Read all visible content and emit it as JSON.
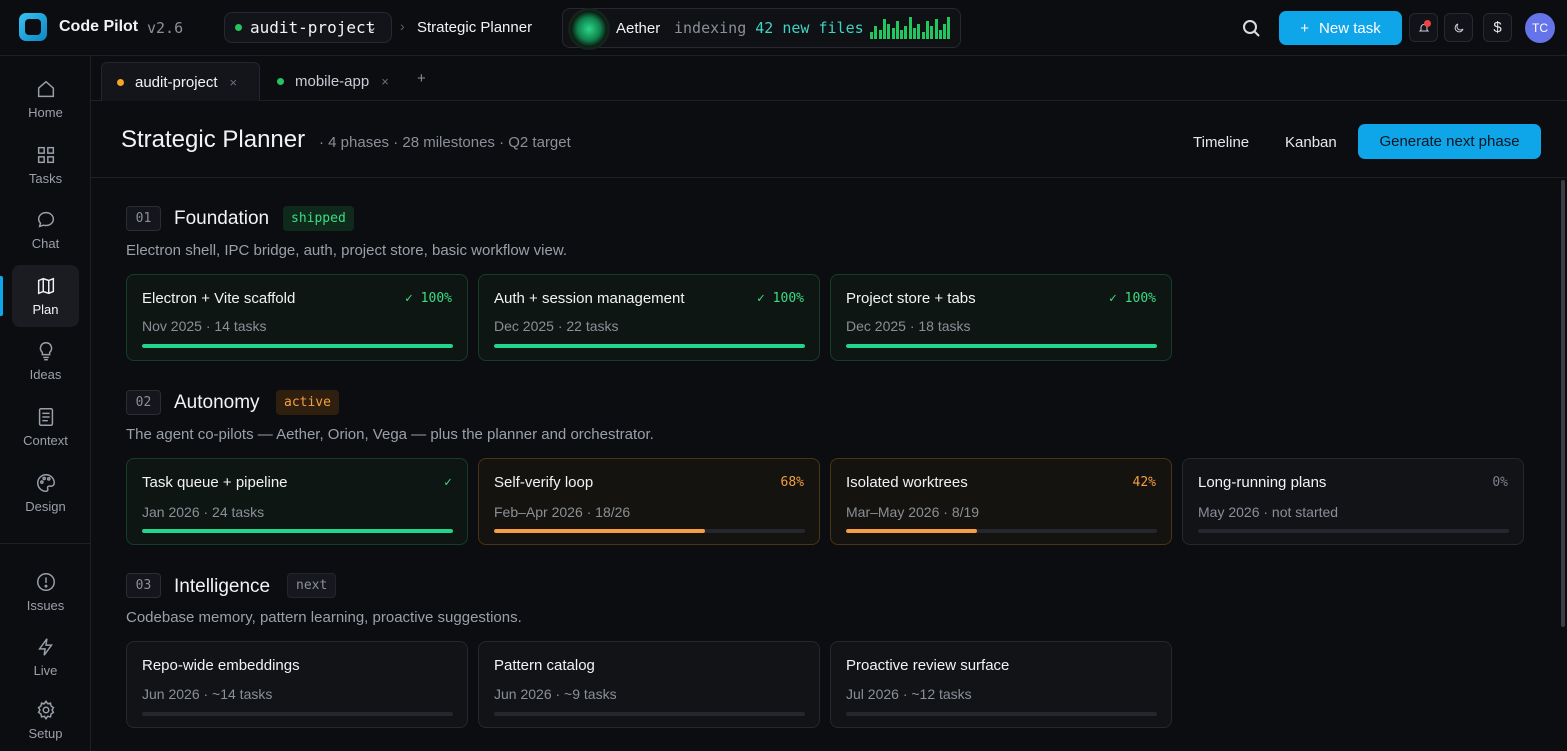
{
  "app": {
    "name": "Code Pilot",
    "version": "v2.6"
  },
  "header": {
    "project": "audit-project",
    "breadcrumb": "Strategic Planner",
    "agent": {
      "name": "Aether",
      "status_prefix": "indexing",
      "status_count": "42 new files",
      "activity": [
        0.3,
        0.6,
        0.4,
        0.9,
        0.7,
        0.5,
        0.8,
        0.4,
        0.6,
        1.0,
        0.5,
        0.7,
        0.3,
        0.8,
        0.6,
        0.9,
        0.4,
        0.7,
        1.0
      ]
    },
    "new_task_label": "New task",
    "avatar_initials": "TC"
  },
  "sidebar": {
    "items": [
      {
        "label": "Home",
        "icon": "home-icon"
      },
      {
        "label": "Tasks",
        "icon": "grid-icon"
      },
      {
        "label": "Chat",
        "icon": "chat-icon"
      },
      {
        "label": "Plan",
        "icon": "map-icon",
        "active": true
      },
      {
        "label": "Ideas",
        "icon": "lightbulb-icon"
      },
      {
        "label": "Context",
        "icon": "document-icon"
      },
      {
        "label": "Design",
        "icon": "palette-icon"
      }
    ],
    "bottom_items": [
      {
        "label": "Issues",
        "icon": "alert-circle-icon"
      },
      {
        "label": "Live",
        "icon": "bolt-icon"
      },
      {
        "label": "Setup",
        "icon": "gear-icon"
      }
    ]
  },
  "tabs": [
    {
      "label": "audit-project",
      "dot_color": "#f5a524",
      "active": true
    },
    {
      "label": "mobile-app",
      "dot_color": "#22c55e",
      "active": false
    }
  ],
  "page": {
    "title": "Strategic Planner",
    "meta": "· 4 phases · 28 milestones · Q2 target",
    "views": [
      "Timeline",
      "Kanban"
    ],
    "primary_action": "Generate next phase"
  },
  "phases": [
    {
      "num": "01",
      "title": "Foundation",
      "badge": "shipped",
      "desc": "Electron shell, IPC bridge, auth, project store, basic workflow view.",
      "cards": [
        {
          "title": "Electron + Vite scaffold",
          "pct": "✓ 100%",
          "sub": "Nov 2025 · 14 tasks",
          "progress": 1.0
        },
        {
          "title": "Auth + session management",
          "pct": "✓ 100%",
          "sub": "Dec 2025 · 22 tasks",
          "progress": 1.0
        },
        {
          "title": "Project store + tabs",
          "pct": "✓ 100%",
          "sub": "Dec 2025 · 18 tasks",
          "progress": 1.0
        }
      ]
    },
    {
      "num": "02",
      "title": "Autonomy",
      "badge": "active",
      "desc": "The agent co-pilots — Aether, Orion, Vega — plus the planner and orchestrator.",
      "cards": [
        {
          "title": "Task queue + pipeline",
          "pct": "✓",
          "sub": "Jan 2026 · 24 tasks",
          "progress": 1.0
        },
        {
          "title": "Self-verify loop",
          "pct": "68%",
          "sub": "Feb–Apr 2026 · 18/26",
          "progress": 0.68
        },
        {
          "title": "Isolated worktrees",
          "pct": "42%",
          "sub": "Mar–May 2026 · 8/19",
          "progress": 0.42
        },
        {
          "title": "Long-running plans",
          "pct": "0%",
          "sub": "May 2026 · not started",
          "progress": 0
        }
      ]
    },
    {
      "num": "03",
      "title": "Intelligence",
      "badge": "next",
      "desc": "Codebase memory, pattern learning, proactive suggestions.",
      "cards": [
        {
          "title": "Repo-wide embeddings",
          "sub": "Jun 2026 · ~14 tasks",
          "progress": 0
        },
        {
          "title": "Pattern catalog",
          "sub": "Jun 2026 · ~9 tasks",
          "progress": 0
        },
        {
          "title": "Proactive review surface",
          "sub": "Jul 2026 · ~12 tasks",
          "progress": 0
        }
      ]
    }
  ]
}
